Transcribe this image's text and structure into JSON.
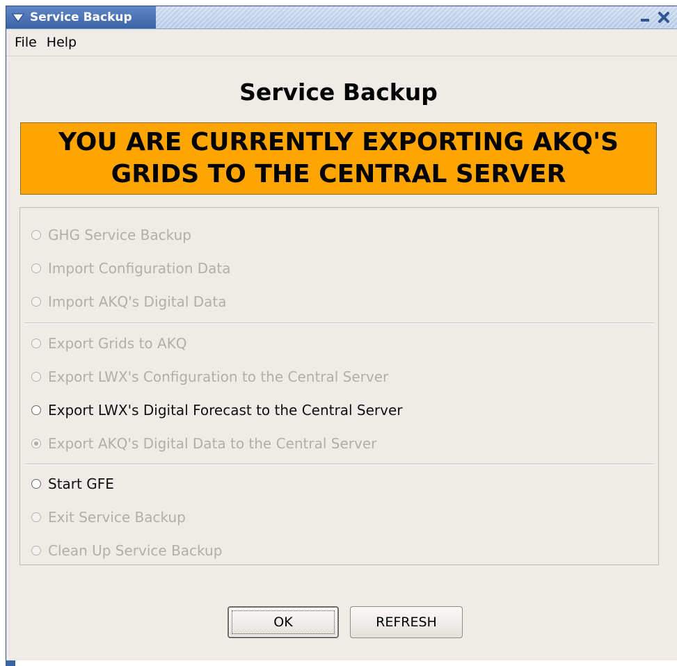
{
  "window": {
    "title": "Service Backup",
    "colors": {
      "titlebar_accent": "#3b64a7",
      "banner": "#ffa500",
      "background": "#efebe7"
    }
  },
  "menubar": {
    "items": [
      {
        "label": "File"
      },
      {
        "label": "Help"
      }
    ]
  },
  "heading": "Service Backup",
  "banner": {
    "text": "YOU ARE CURRENTLY EXPORTING AKQ'S GRIDS TO THE CENTRAL SERVER"
  },
  "options": {
    "group1": [
      {
        "label": "GHG Service Backup",
        "enabled": false,
        "selected": false
      },
      {
        "label": "Import Configuration Data",
        "enabled": false,
        "selected": false
      },
      {
        "label": "Import AKQ's Digital Data",
        "enabled": false,
        "selected": false
      }
    ],
    "group2": [
      {
        "label": "Export Grids to AKQ",
        "enabled": false,
        "selected": false
      },
      {
        "label": "Export LWX's Configuration to the Central Server",
        "enabled": false,
        "selected": false
      },
      {
        "label": "Export LWX's Digital Forecast to the Central Server",
        "enabled": true,
        "selected": false
      },
      {
        "label": "Export AKQ's Digital Data to the Central Server",
        "enabled": false,
        "selected": true
      }
    ],
    "group3": [
      {
        "label": "Start GFE",
        "enabled": true,
        "selected": false
      },
      {
        "label": "Exit Service Backup",
        "enabled": false,
        "selected": false
      },
      {
        "label": "Clean Up Service Backup",
        "enabled": false,
        "selected": false
      }
    ]
  },
  "buttons": {
    "ok": "OK",
    "refresh": "REFRESH"
  },
  "icons": {
    "window_menu": "chevron-down-icon",
    "minimize": "minimize-icon",
    "close": "close-icon"
  }
}
